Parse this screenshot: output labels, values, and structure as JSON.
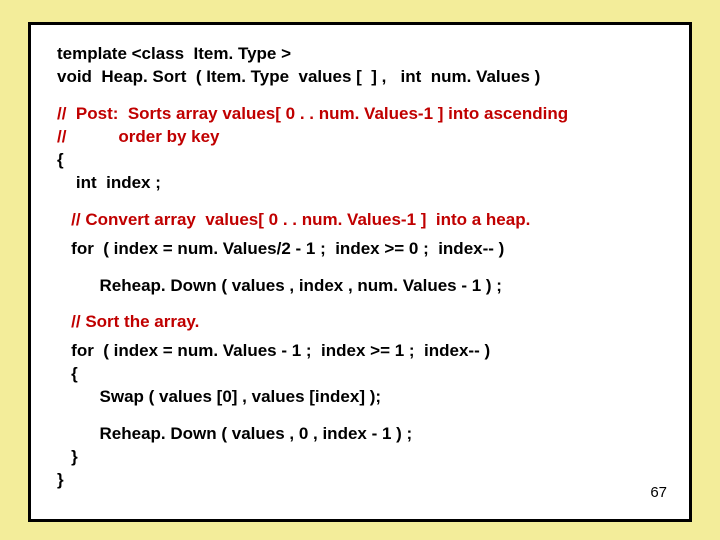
{
  "code": {
    "l1": "template <class  Item. Type >",
    "l2": "void  Heap. Sort  ( Item. Type  values [  ] ,   int  num. Values )",
    "l3": "//  Post:  Sorts array values[ 0 . . num. Values-1 ] into ascending",
    "l4": "//           order by key",
    "l5": "{",
    "l6": "    int  index ;",
    "l7": "   // Convert array  values[ 0 . . num. Values-1 ]  into a heap.",
    "l8": "   for  ( index = num. Values/2 - 1 ;  index >= 0 ;  index-- )",
    "l9": "         Reheap. Down ( values , index , num. Values - 1 ) ;",
    "l10": "   // Sort the array.",
    "l11": "   for  ( index = num. Values - 1 ;  index >= 1 ;  index-- )",
    "l12": "   {",
    "l13": "         Swap ( values [0] , values [index] );",
    "l14": "         Reheap. Down ( values , 0 , index - 1 ) ;",
    "l15": "   }",
    "l16": "}"
  },
  "page_number": "67"
}
